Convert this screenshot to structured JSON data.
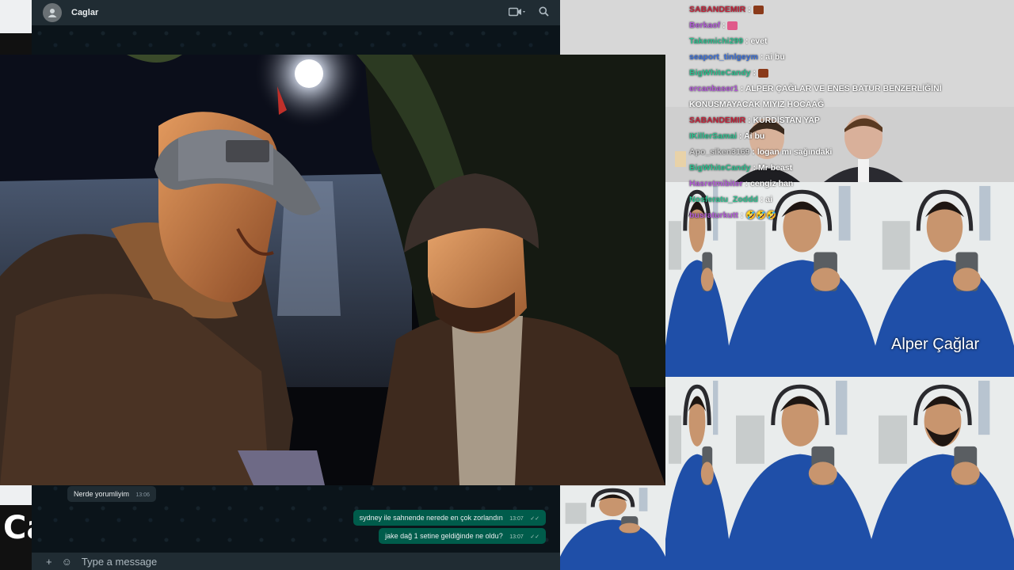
{
  "whatsapp": {
    "contact_name": "Caglar",
    "input_placeholder": "Type a message",
    "messages": [
      {
        "direction": "in",
        "text": "Nerde yorumliyim",
        "time": "13:06"
      },
      {
        "direction": "out",
        "text": "sydney ile sahnende nerede en çok zorlandın",
        "time": "13:07"
      },
      {
        "direction": "out",
        "text": "jake dağ 1 setine geldiğinde ne oldu?",
        "time": "13:07"
      }
    ]
  },
  "brand_text": "Ca",
  "chat": {
    "lines": [
      {
        "user": "SABANDEMIR",
        "color": "#c0233a",
        "message": "",
        "emote": "#8a3a1a"
      },
      {
        "user": "Berkaof",
        "color": "#b15bd6",
        "message": "",
        "emote": "#e05a8a"
      },
      {
        "user": "Takemichi299",
        "color": "#2ebf8f",
        "message": "evet"
      },
      {
        "user": "seaport_tinlgeym",
        "color": "#3a6fd8",
        "message": "ai bu"
      },
      {
        "user": "BigWhiteCandy",
        "color": "#2ebf8f",
        "message": "",
        "emote": "#8a3a1a"
      },
      {
        "user": "ercanbaser1",
        "color": "#b15bd6",
        "message": "ALPER ÇAĞLAR VE ENES BATUR BENZERLİĞİNİ"
      },
      {
        "user": "",
        "color": "#ffffff",
        "message": "KONUSMAYACAK MIYIZ HOCAAĞ"
      },
      {
        "user": "SABANDEMIR",
        "color": "#c0233a",
        "message": "KURDİSTAN YAP"
      },
      {
        "user": "IKillerSamai",
        "color": "#2ebf8f",
        "message": "Ai bu"
      },
      {
        "user": "Apo_siken3169",
        "color": "#cfcfcf",
        "message": "logan mı sağındaki"
      },
      {
        "user": "BigWhiteCandy",
        "color": "#2ebf8f",
        "message": "Mr beast"
      },
      {
        "user": "Hasretmibiter",
        "color": "#b15bd6",
        "message": "cengiz han"
      },
      {
        "user": "Nosferatu_Zoddd",
        "color": "#2ebf8f",
        "message": "ai"
      },
      {
        "user": "busraturkutt",
        "color": "#b15bd6",
        "message": "🤣🤣🤣"
      }
    ]
  },
  "meme": {
    "caption": "Alper Çağlar"
  },
  "colors": {
    "whatsapp_bg": "#0b141a",
    "whatsapp_header": "#202c33",
    "bubble_out": "#005c4b",
    "bubble_in": "#202c33",
    "shirt_blue": "#1f4fa8"
  }
}
